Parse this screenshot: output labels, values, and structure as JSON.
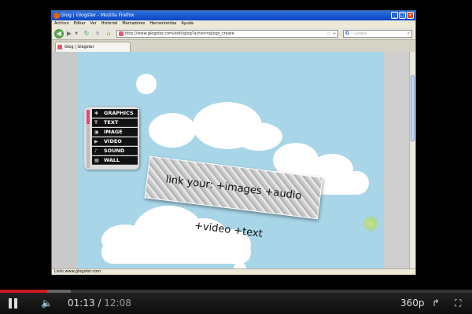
{
  "window": {
    "title": "Glog | Glogster - Mozilla Firefox"
  },
  "menu": [
    "Archivo",
    "Editar",
    "Ver",
    "Historial",
    "Marcadores",
    "Herramientas",
    "Ayuda"
  ],
  "nav": {
    "url": "http://www.glogster.com/edit/glog?action=glogs_create",
    "search_placeholder": "Google"
  },
  "tab": {
    "label": "Glog | Glogster"
  },
  "toolbox": {
    "items": [
      "GRAPHICS",
      "TEXT",
      "IMAGE",
      "VIDEO",
      "SOUND",
      "WALL"
    ]
  },
  "banner": {
    "text": "link your: +images +audio +video +text"
  },
  "status": {
    "text": "Listo www.glogster.com"
  },
  "player": {
    "current_time": "01:13",
    "duration": "12:08",
    "time_separator": "/",
    "quality": "360p",
    "played_fraction": 0.1,
    "buffered_fraction": 0.15
  },
  "colors": {
    "sky": "#a8d5e8",
    "progress_played": "#cc181e",
    "toolbox_accent": "#e0457b"
  },
  "icons": {
    "pause": "pause-icon",
    "volume": "volume-icon",
    "share": "share-icon",
    "fullscreen": "fullscreen-icon"
  }
}
